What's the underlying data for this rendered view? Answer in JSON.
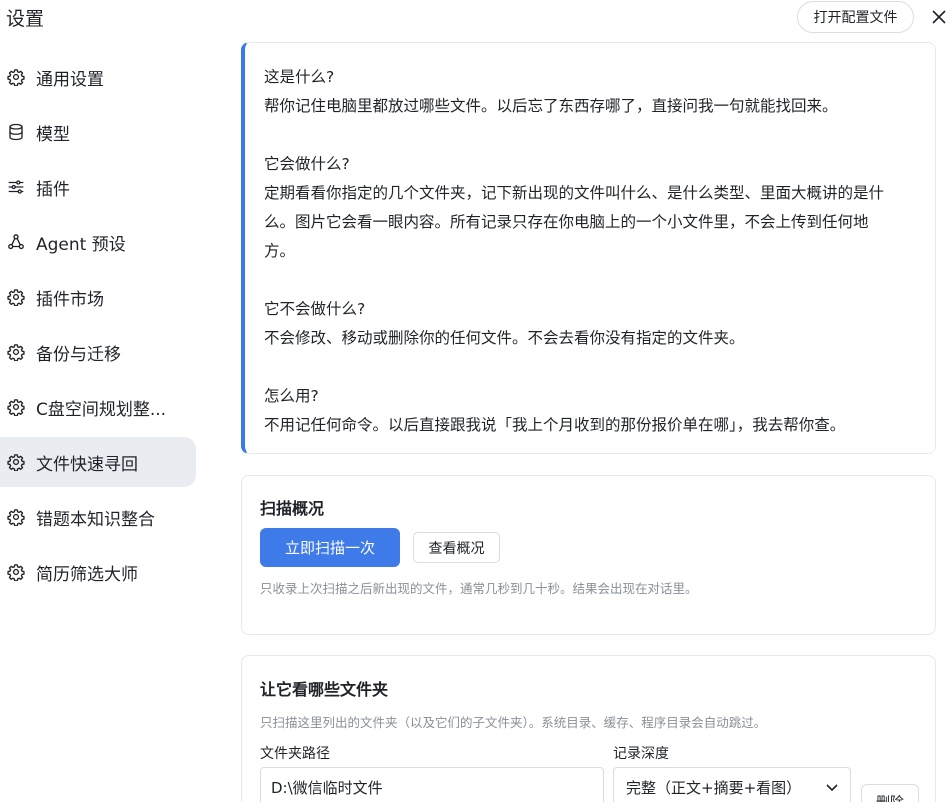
{
  "header": {
    "title": "设置",
    "open_config_label": "打开配置文件"
  },
  "sidebar": {
    "active_index": 7,
    "items": [
      {
        "label": "通用设置",
        "icon": "gear-icon"
      },
      {
        "label": "模型",
        "icon": "database-icon"
      },
      {
        "label": "插件",
        "icon": "sliders-icon"
      },
      {
        "label": "Agent 预设",
        "icon": "agent-network-icon"
      },
      {
        "label": "插件市场",
        "icon": "gear-icon"
      },
      {
        "label": "备份与迁移",
        "icon": "gear-icon"
      },
      {
        "label": "C盘空间规划整...",
        "icon": "gear-icon"
      },
      {
        "label": "文件快速寻回",
        "icon": "gear-icon"
      },
      {
        "label": "错题本知识整合",
        "icon": "gear-icon"
      },
      {
        "label": "简历筛选大师",
        "icon": "gear-icon"
      }
    ]
  },
  "info": {
    "q1": "这是什么?",
    "a1": "帮你记住电脑里都放过哪些文件。以后忘了东西存哪了，直接问我一句就能找回来。",
    "q2": "它会做什么?",
    "a2_line1": "定期看看你指定的几个文件夹，记下新出现的文件叫什么、是什么类型、里面大概讲的是什",
    "a2_line2": "么。图片它会看一眼内容。所有记录只存在你电脑上的一个小文件里，不会上传到任何地",
    "a2_line3": "方。",
    "q3": "它不会做什么?",
    "a3": "不会修改、移动或删除你的任何文件。不会去看你没有指定的文件夹。",
    "q4": "怎么用?",
    "a4": "不用记任何命令。以后直接跟我说「我上个月收到的那份报价单在哪」，我去帮你查。"
  },
  "scan": {
    "title": "扫描概况",
    "scan_now_label": "立即扫描一次",
    "view_label": "查看概况",
    "hint": "只收录上次扫描之后新出现的文件，通常几秒到几十秒。结果会出现在对话里。"
  },
  "folders": {
    "title": "让它看哪些文件夹",
    "hint": "只扫描这里列出的文件夹（以及它们的子文件夹）。系统目录、缓存、程序目录会自动跳过。",
    "path_label": "文件夹路径",
    "depth_label": "记录深度",
    "rows": [
      {
        "path": "D:\\微信临时文件",
        "depth": "完整（正文+摘要+看图）",
        "delete_label": "删除"
      }
    ]
  },
  "colors": {
    "accent": "#3e7ae8",
    "active_bg": "#e9ecf1",
    "border": "#e6e8eb",
    "hint_text": "#8a9099"
  }
}
